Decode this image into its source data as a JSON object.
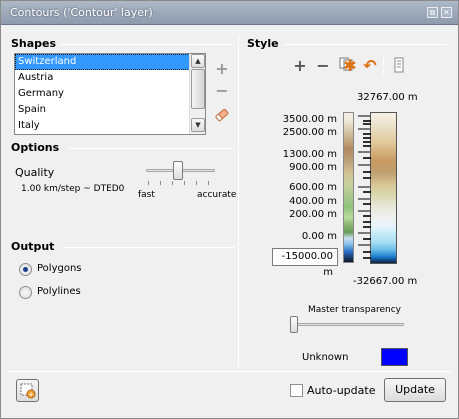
{
  "window": {
    "title": "Contours ('Contour' layer)",
    "restore_glyph": "⧉",
    "close_glyph": "✕"
  },
  "shapes": {
    "heading": "Shapes",
    "items": [
      {
        "label": "Switzerland",
        "selected": true
      },
      {
        "label": "Austria",
        "selected": false
      },
      {
        "label": "Germany",
        "selected": false
      },
      {
        "label": "Spain",
        "selected": false
      },
      {
        "label": "Italy",
        "selected": false
      }
    ],
    "icons": [
      "add-icon",
      "remove-icon",
      "eraser-icon"
    ],
    "add_glyph": "+",
    "remove_glyph": "−"
  },
  "options": {
    "heading": "Options",
    "quality_label": "Quality",
    "quality_value": "1.00 km/step ~ DTED0",
    "slider_min_label": "fast",
    "slider_max_label": "accurate",
    "quality_level": 0.45
  },
  "output": {
    "heading": "Output",
    "options": [
      {
        "label": "Polygons",
        "selected": true
      },
      {
        "label": "Polylines",
        "selected": false
      }
    ]
  },
  "style": {
    "heading": "Style",
    "toolbar_icons": [
      "add-stop-icon",
      "remove-stop-icon",
      "copy-icon",
      "star-icon",
      "undo-icon",
      "settings-icon"
    ],
    "add_glyph": "+",
    "remove_glyph": "−",
    "star_glyph": "✱",
    "undo_glyph": "↶",
    "max_value": "32767.00 m",
    "min_value": "-32667.00 m",
    "levels": [
      "3500.00 m",
      "2500.00 m",
      "1300.00 m",
      "900.00 m",
      "600.00 m",
      "400.00 m",
      "200.00 m",
      "0.00 m"
    ],
    "edit_value": "-15000.00 m",
    "transparency_label": "Master transparency",
    "transparency_level": 0.0,
    "unknown_label": "Unknown",
    "unknown_color": "#0000ff"
  },
  "footer": {
    "autoupdate_label": "Auto-update",
    "autoupdate_checked": false,
    "update_button": "Update"
  }
}
